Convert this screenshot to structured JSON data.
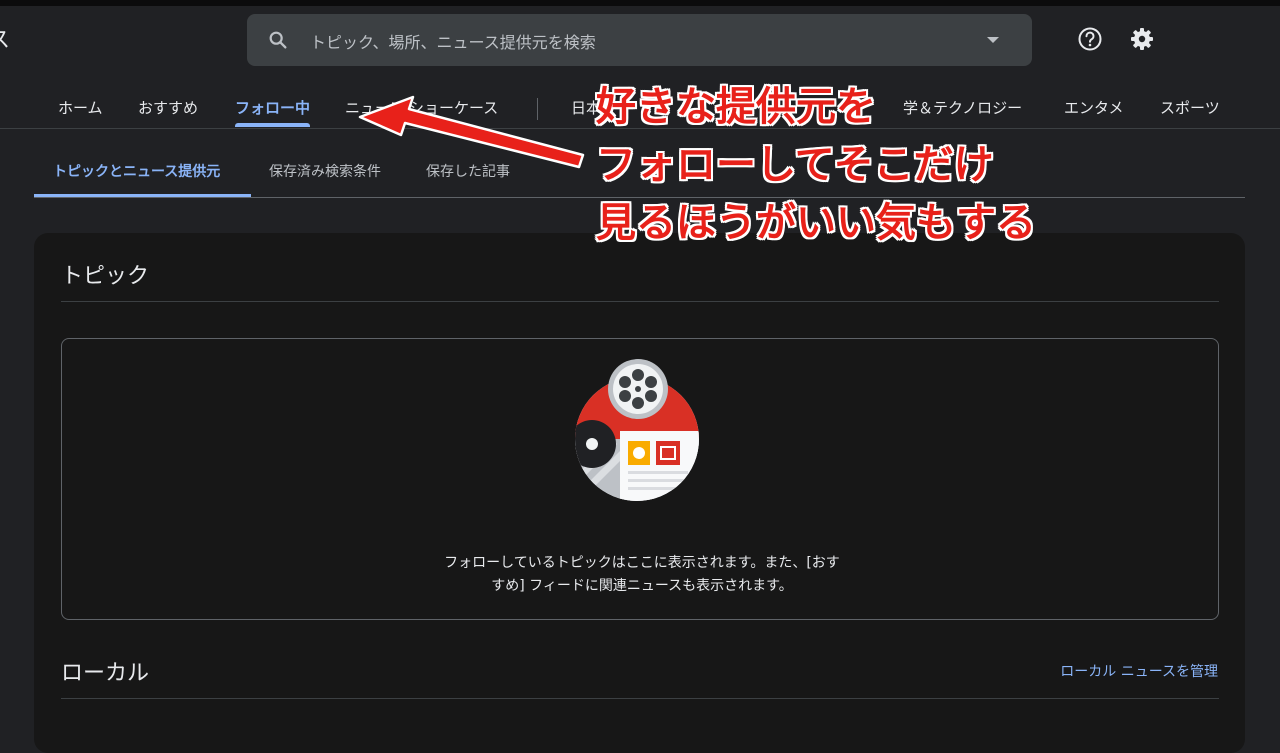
{
  "app": {
    "title_fragment": "ス"
  },
  "search": {
    "placeholder": "トピック、場所、ニュース提供元を検索"
  },
  "icons": {
    "search": "search-icon",
    "dropdown": "chevron-down-icon",
    "help": "help-icon",
    "settings": "gear-icon"
  },
  "nav": {
    "items": [
      "ホーム",
      "おすすめ",
      "フォロー中",
      "ニュース ショーケース",
      "日本",
      "学＆テクノロジー",
      "エンタメ",
      "スポーツ"
    ],
    "active": "フォロー中"
  },
  "subtabs": {
    "items": [
      "トピックとニュース提供元",
      "保存済み検索条件",
      "保存した記事"
    ],
    "active": "トピックとニュース提供元"
  },
  "topics": {
    "title": "トピック",
    "empty_line1": "フォローしているトピックはここに表示されます。また、[おす",
    "empty_line2": "すめ] フィードに関連ニュースも表示されます。"
  },
  "local": {
    "title": "ローカル",
    "manage_link": "ローカル ニュースを管理"
  },
  "annotation": {
    "line1": "好きな提供元を",
    "line2": "フォローしてそこだけ",
    "line3": "見るほうがいい気もする"
  },
  "colors": {
    "accent": "#8ab4f8",
    "annotation": "#e8211a",
    "background": "#202124",
    "panel": "#171717"
  }
}
